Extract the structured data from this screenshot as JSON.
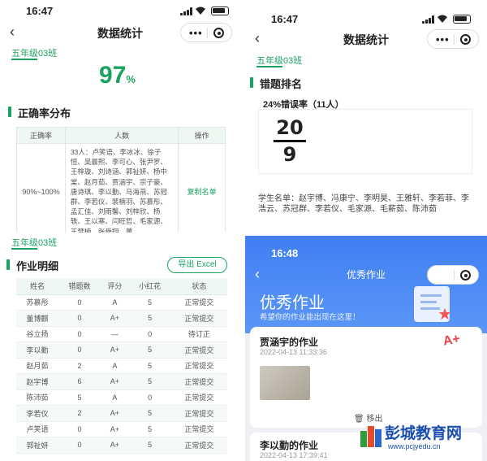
{
  "status": {
    "time_left": "16:47",
    "time_right": "16:47",
    "time_br": "16:48"
  },
  "stats_page": {
    "nav_title": "数据统计",
    "class_name": "五年级03班",
    "accuracy": "97",
    "accuracy_unit": "%",
    "accuracy_section": "正确率分布",
    "table_headers": [
      "正确率",
      "人数",
      "操作"
    ],
    "row_range": "90%~100%",
    "row_names": "33人：卢笑语、李冰冰、徐子恒、吴晨熙、李可心、张尹罗、王梓璇、刘诗涵、郭祉妍、杨中棠、赵月茹、贾涵宇、宗子豪、唐诗琪、李以勤、马海燕、苏冠群、李若仪、裴楠羽、苏慕彤、孟汇佳、刘雨馨、刘梓欣、杨轶、王以寒、闫旺哲、毛家源、王梦楠、张舜翔、董",
    "row_action": "复制名单",
    "errors_section": "错题排名",
    "error_rate": "24%错误率（11人）",
    "fraction_top": "20",
    "fraction_bottom": "9",
    "student_list": "学生名单：赵宇博、冯康宁、李明昊、王雅轩、李若菲、李浩云、苏冠群、李若仪、毛家源、毛薪茹、陈沛茹"
  },
  "homework": {
    "class_name": "五年级03班",
    "section_title": "作业明细",
    "export_label": "导出 Excel",
    "headers": [
      "姓名",
      "错题数",
      "评分",
      "小红花",
      "状态"
    ],
    "rows": [
      [
        "苏慕彤",
        "0",
        "A",
        "5",
        "正常提交"
      ],
      [
        "董博麒",
        "0",
        "A+",
        "5",
        "正常提交"
      ],
      [
        "谷立扬",
        "0",
        "—",
        "0",
        "待订正"
      ],
      [
        "李以勤",
        "0",
        "A+",
        "5",
        "正常提交"
      ],
      [
        "赵月茹",
        "2",
        "A",
        "5",
        "正常提交"
      ],
      [
        "赵宇博",
        "6",
        "A+",
        "5",
        "正常提交"
      ],
      [
        "陈沛茹",
        "5",
        "A",
        "0",
        "正常提交"
      ],
      [
        "李若仪",
        "2",
        "A+",
        "5",
        "正常提交"
      ],
      [
        "卢笑语",
        "0",
        "A+",
        "5",
        "正常提交"
      ],
      [
        "郭祉妍",
        "0",
        "A+",
        "5",
        "正常提交"
      ]
    ]
  },
  "excellent": {
    "nav_title": "优秀作业",
    "banner_title": "优秀作业",
    "banner_sub": "希望你的作业能出现在这里！",
    "card1_title": "贾涵宇的作业",
    "card1_time": "2022-04-13 11:33:36",
    "remove_label": "移出",
    "card2_title": "李以勤的作业",
    "card2_time": "2022-04-13 17:39:41",
    "badge": "A+"
  },
  "watermark": {
    "name": "彭城教育网",
    "url": "www.pcjyedu.cn"
  },
  "colors": {
    "accent": "#1aa260",
    "blue": "#3d7bf0",
    "banner": "#4a86f5"
  },
  "icons": [
    "back-icon",
    "more-dots-icon",
    "target-icon",
    "signal-icon",
    "wifi-icon",
    "battery-icon",
    "trash-icon"
  ]
}
